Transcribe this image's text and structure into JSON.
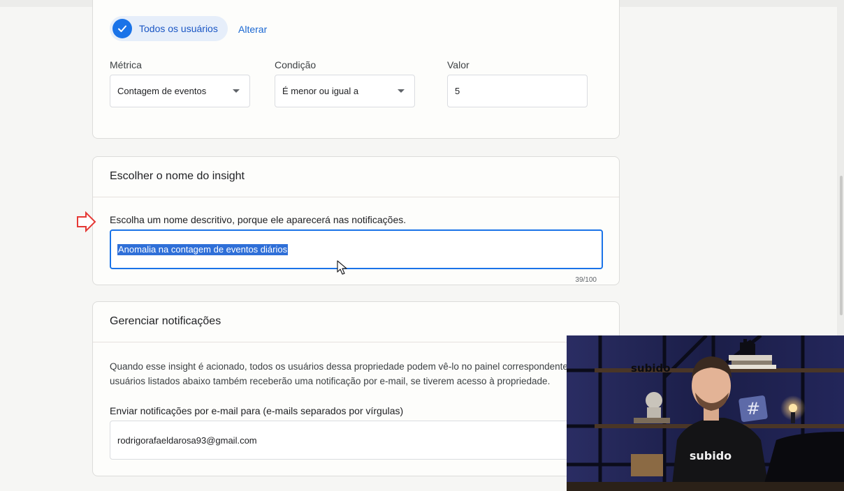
{
  "audience": {
    "chip_label": "Todos os usuários",
    "change_label": "Alterar"
  },
  "condition": {
    "metric_label": "Métrica",
    "metric_value": "Contagem de eventos",
    "condition_label": "Condição",
    "condition_value": "É menor ou igual a",
    "value_label": "Valor",
    "value_value": "5"
  },
  "insight_name": {
    "title": "Escolher o nome do insight",
    "description": "Escolha um nome descritivo, porque ele aparecerá nas notificações.",
    "input_value": "Anomalia na contagem de eventos diários",
    "counter": "39/100"
  },
  "notifications": {
    "title": "Gerenciar notificações",
    "paragraph_line1": "Quando esse insight é acionado, todos os usuários dessa propriedade podem vê-lo no painel correspondente",
    "paragraph_line2": "usuários listados abaixo também receberão uma notificação por e-mail, se tiverem acesso à propriedade.",
    "email_label": "Enviar notificações por e-mail para (e-mails separados por vírgulas)",
    "email_value": "rodrigorafaeldarosa93@gmail.com"
  },
  "overlay": {
    "brand_sign": "subido",
    "shirt_logo": "subido",
    "hash_sign": "#"
  },
  "colors": {
    "accent": "#1a73e8",
    "arrow_red": "#e53935",
    "selection": "#2f6fd8"
  }
}
